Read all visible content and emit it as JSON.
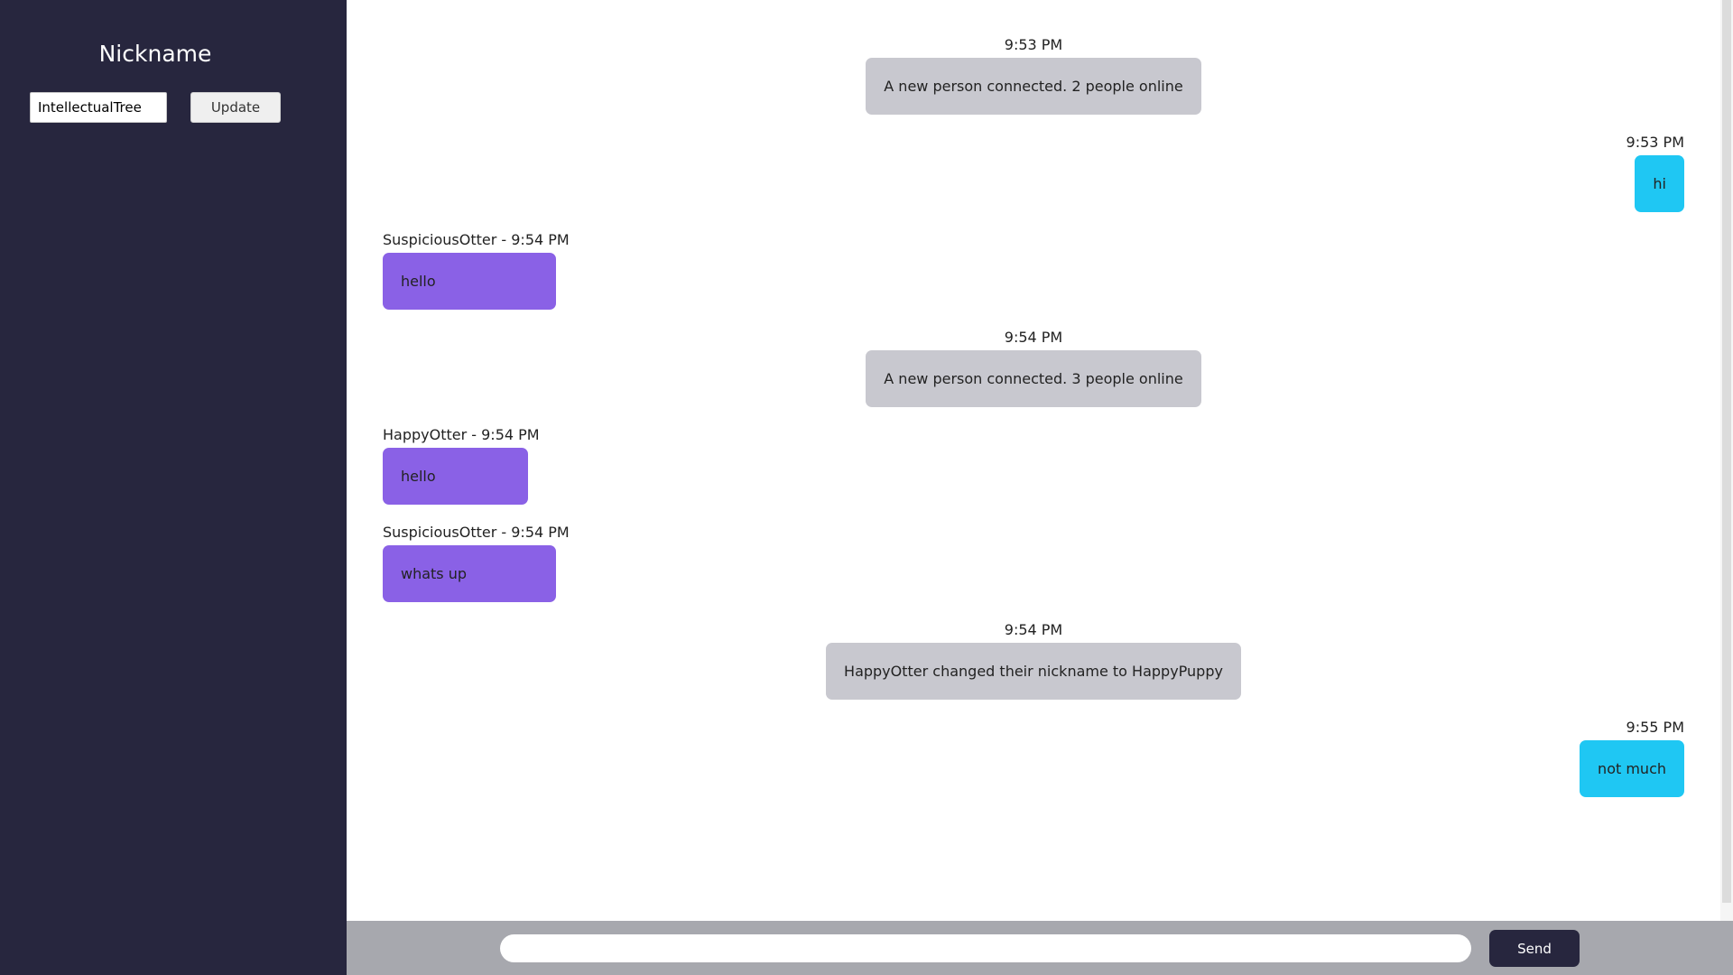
{
  "sidebar": {
    "title": "Nickname",
    "nickname_value": "IntellectualTree",
    "update_label": "Update"
  },
  "messages": [
    {
      "type": "system",
      "time": "9:53 PM",
      "text": "A new person connected. 2 people online"
    },
    {
      "type": "mine",
      "time": "9:53 PM",
      "text": "hi"
    },
    {
      "type": "other",
      "meta": "SuspiciousOtter - 9:54 PM",
      "text": "hello"
    },
    {
      "type": "system",
      "time": "9:54 PM",
      "text": "A new person connected. 3 people online"
    },
    {
      "type": "other",
      "meta": "HappyOtter - 9:54 PM",
      "text": "hello"
    },
    {
      "type": "other",
      "meta": "SuspiciousOtter - 9:54 PM",
      "text": "whats up"
    },
    {
      "type": "system",
      "time": "9:54 PM",
      "text": "HappyOtter changed their nickname to HappyPuppy"
    },
    {
      "type": "mine",
      "time": "9:55 PM",
      "text": "not much"
    }
  ],
  "composer": {
    "placeholder": "",
    "send_label": "Send"
  },
  "colors": {
    "sidebar_bg": "#27263e",
    "system_bubble": "#c8c8cf",
    "mine_bubble": "#1fc7f3",
    "other_bubble": "#8a61e6",
    "composer_bg": "#a7a8ae"
  }
}
